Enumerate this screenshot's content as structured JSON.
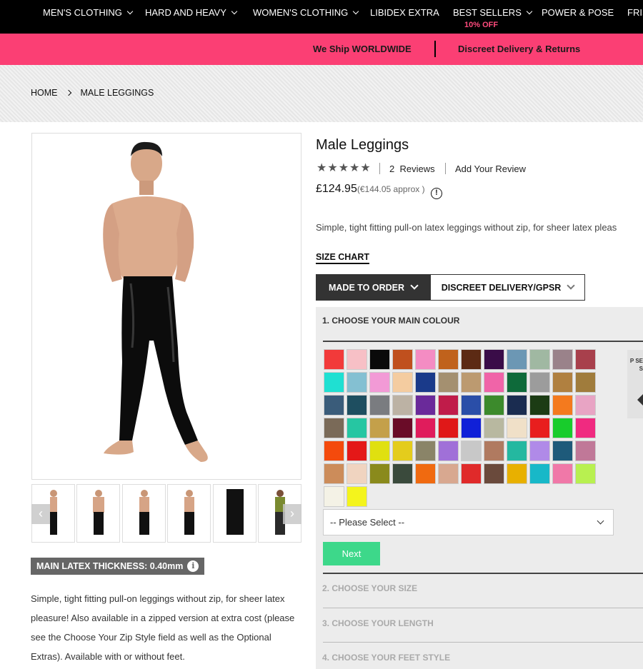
{
  "nav": {
    "items": [
      "MEN'S CLOTHING",
      "HARD AND HEAVY",
      "WOMEN'S CLOTHING",
      "LIBIDEX EXTRA",
      "BEST SELLERS",
      "POWER & POSE",
      "FRIS"
    ],
    "best_sellers_offer": "10% OFF"
  },
  "promo": {
    "left": "We Ship WORLDWIDE",
    "right": "Discreet Delivery & Returns"
  },
  "breadcrumb": {
    "home": "HOME",
    "current": "MALE LEGGINGS"
  },
  "gallery": {
    "thumb_count": 6,
    "prev_icon": "chevron-left-icon",
    "next_icon": "chevron-right-icon"
  },
  "product": {
    "title": "Male Leggings",
    "stars": "★★★★★",
    "rating": 5,
    "review_count": "2",
    "reviews_label": "Reviews",
    "add_review": "Add Your Review",
    "price": "£124.95",
    "price_approx": "(€144.05 approx )",
    "short_description": "Simple, tight fitting pull-on latex leggings without zip, for sheer latex pleas",
    "size_chart": "SIZE CHART",
    "thickness_label": "MAIN LATEX THICKNESS: 0.40mm",
    "description": "Simple, tight fitting pull-on leggings without zip, for sheer latex pleasure! Also available in a zipped version at extra cost (please see the Choose Your Zip Style field as well as the Optional Extras). Available with or without feet."
  },
  "tabs": {
    "made_to_order": "MADE TO ORDER",
    "discreet": "DISCREET DELIVERY/GPSR"
  },
  "configurator": {
    "step1": "1. CHOOSE YOUR MAIN COLOUR",
    "step2": "2. CHOOSE YOUR SIZE",
    "step3": "3. CHOOSE YOUR LENGTH",
    "step4": "4. CHOOSE YOUR FEET STYLE",
    "select_placeholder": "-- Please Select --",
    "next_label": "Next",
    "side_card_text": "P SE S"
  },
  "swatch_colors": [
    "#f23a3a",
    "#f7c0c6",
    "#0a0a0a",
    "#c0501e",
    "#f48cc3",
    "#c0621c",
    "#5c2a14",
    "#3a0c48",
    "#6c97b4",
    "#a0b8a2",
    "#9a828a",
    "#a8404c",
    "#1fe0d2",
    "#84c0d2",
    "#f29ad6",
    "#f4cca0",
    "#1a3a8a",
    "#a49070",
    "#bc9a70",
    "#f064a8",
    "#0e6a3a",
    "#9c9c9c",
    "#b08040",
    "#a07c3c",
    "#3a5c7a",
    "#1e4e60",
    "#7a7c80",
    "#bcb2a4",
    "#6a2a9a",
    "#c01c4a",
    "#2a4ea8",
    "#3c8a2c",
    "#1a2c50",
    "#1c3c14",
    "#f47a1e",
    "#e8a4c4",
    "#7a6a58",
    "#26c6a2",
    "#c4a04a",
    "#6a0c28",
    "#e01c5c",
    "#e01818",
    "#1020d8",
    "#b8b8a0",
    "#f0e0c8",
    "#e81e1e",
    "#18cc2c",
    "#f02a80",
    "#f44a0c",
    "#e41818",
    "#e0e010",
    "#e4cc1c",
    "#8a8468",
    "#a070d8",
    "#c8c8c8",
    "#b07a60",
    "#24b8a0",
    "#b08ae8",
    "#1e5a7a",
    "#c07898",
    "#cc8c5a",
    "#f0d4c0",
    "#8a8a1c",
    "#3a4a3c",
    "#f06a10",
    "#d8a890",
    "#e02a2a",
    "#6a4a3c",
    "#e8b000",
    "#18b8c8",
    "#f078a8",
    "#b8f050",
    "#f4f2e6",
    "#f4f41c"
  ]
}
